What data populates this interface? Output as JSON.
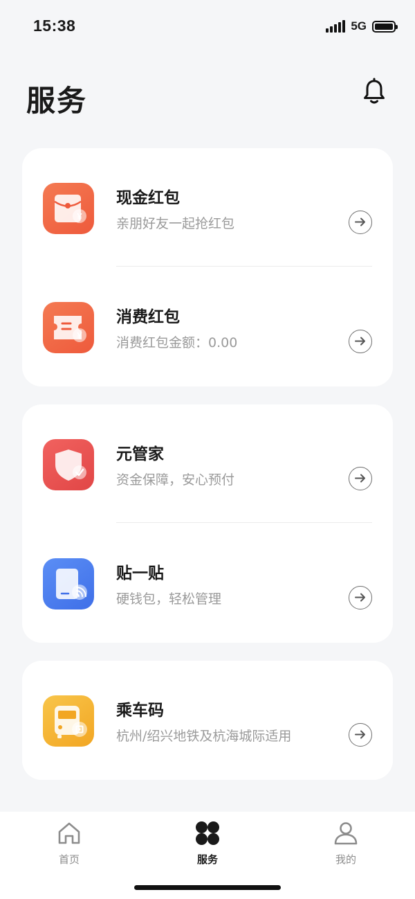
{
  "status_bar": {
    "time": "15:38",
    "network": "5G",
    "icons": [
      "signal-icon",
      "battery-icon"
    ]
  },
  "header": {
    "title": "服务",
    "icon": "bell-icon"
  },
  "cards": [
    {
      "rows": [
        {
          "title": "现金红包",
          "subtitle": "亲朋好友一起抢红包",
          "icon": "red-envelope-icon",
          "color": "#f06a49"
        },
        {
          "title": "消费红包",
          "subtitle": "消费红包金额：0.00",
          "icon": "coupon-icon",
          "color": "#f06a49"
        }
      ]
    },
    {
      "rows": [
        {
          "title": "元管家",
          "subtitle": "资金保障，安心预付",
          "icon": "shield-icon",
          "color": "#e85452"
        },
        {
          "title": "贴一贴",
          "subtitle": "硬钱包，轻松管理",
          "icon": "nfc-card-icon",
          "color": "#4d7ff0"
        }
      ]
    },
    {
      "rows": [
        {
          "title": "乘车码",
          "subtitle": "杭州/绍兴地铁及杭海城际适用",
          "icon": "bus-icon",
          "color": "#f5b535"
        }
      ]
    }
  ],
  "tab_bar": {
    "tabs": [
      {
        "label": "首页",
        "icon": "home-icon",
        "active": false
      },
      {
        "label": "服务",
        "icon": "services-icon",
        "active": true
      },
      {
        "label": "我的",
        "icon": "profile-icon",
        "active": false
      }
    ]
  }
}
